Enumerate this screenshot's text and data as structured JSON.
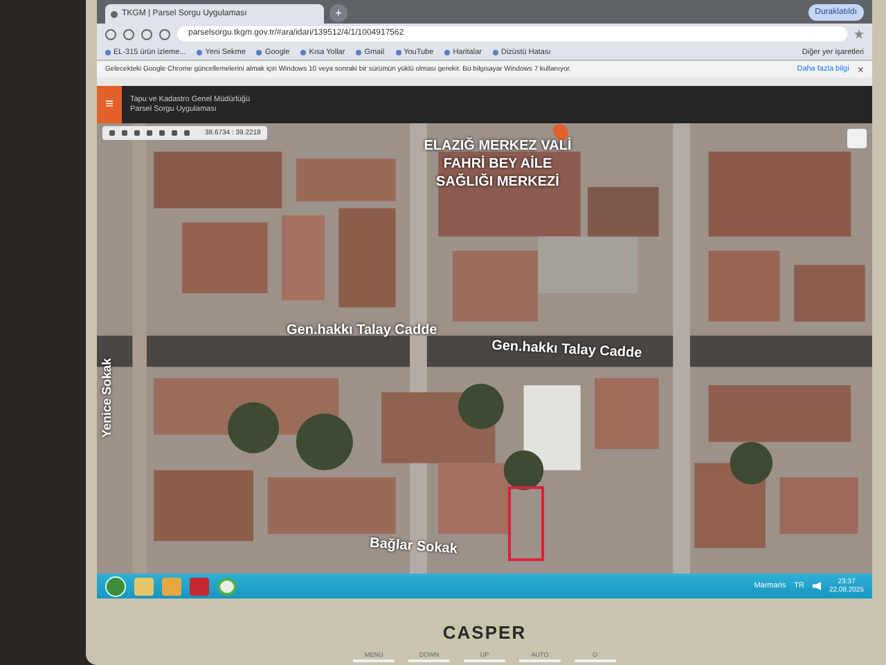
{
  "browser": {
    "tab_title": "TKGM | Parsel Sorgu Uygulaması",
    "new_tab": "+",
    "address": "parselsorgu.tkgm.gov.tr/#ara/idari/139512/4/1/1004917562",
    "profile": "Duraklatıldı",
    "bookmarks": [
      {
        "label": "EL-315 ürün izleme..."
      },
      {
        "label": "Yeni Sekme"
      },
      {
        "label": "Google"
      },
      {
        "label": "Kısa Yollar"
      },
      {
        "label": "Gmail"
      },
      {
        "label": "YouTube"
      },
      {
        "label": "Haritalar"
      },
      {
        "label": "Dizüstü Hatası"
      }
    ],
    "other_bookmarks": "Diğer yer işaretleri",
    "infobar": {
      "text": "Gelecekteki Google Chrome güncellemelerini almak için Windows 10 veya sonraki bir sürümün yüklü olması gerekir. Bu bilgisayar Windows 7 kullanıyor.",
      "link": "Daha fazla bilgi",
      "close": "×"
    }
  },
  "app_header": {
    "menu": "≡",
    "title": "Tapu ve Kadastro Genel Müdürlüğü",
    "subtitle": "Parsel Sorgu Uygulaması"
  },
  "map": {
    "coordinates": "38.6734 : 39.2218",
    "labels": [
      {
        "kind": "poi",
        "text": "ELAZIĞ MERKEZ VALİ FAHRİ BEY AİLE SAĞLIĞI MERKEZİ"
      },
      {
        "kind": "street",
        "text": "Gen.hakkı Talay Cadde"
      },
      {
        "kind": "street2",
        "text": "Gen.hakkı Talay Cadde"
      },
      {
        "kind": "vertical",
        "text": "Yenice Sokak"
      },
      {
        "kind": "bottom",
        "text": "Bağlar Sokak"
      }
    ]
  },
  "taskbar": {
    "weather": "Marmaris",
    "language": "TR",
    "time": "23:37",
    "date": "22.08.2025"
  },
  "monitor": {
    "brand": "CASPER",
    "buttons": [
      "MENU",
      "DOWN",
      "UP",
      "AUTO",
      "⏻"
    ]
  }
}
